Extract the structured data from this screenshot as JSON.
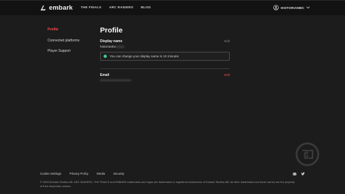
{
  "header": {
    "logo_text": "embark",
    "nav": [
      "THE FINALS",
      "ARC RAIDERS",
      "BLOG"
    ],
    "user_name": "HISTORIANBC"
  },
  "sidebar": {
    "items": [
      {
        "label": "Profile",
        "active": true
      },
      {
        "label": "Connected platforms",
        "active": false
      },
      {
        "label": "Player Support",
        "active": false
      }
    ]
  },
  "main": {
    "title": "Profile",
    "display_name": {
      "label": "Display name",
      "value": "historianbc",
      "edit_label": "Edit",
      "notice": "You can change your display name in 10 minutes"
    },
    "email": {
      "label": "Email",
      "value": "•••••••••••••••••••••••••••",
      "edit_label": "Edit"
    }
  },
  "footer": {
    "links": [
      "Cookie Settings",
      "Privacy Policy",
      "Media",
      "Security"
    ],
    "legal": "© 2025 Embark Studios AB. ARC RAIDERS, THE FINALS and EMBARK trademarks and logos are trademarks or registered trademarks of Embark Studios AB. All other trademarks and trade names are the property of their respective owners."
  },
  "colors": {
    "accent": "#ff4a4a",
    "background": "#1c1c1c",
    "topbar": "#121212",
    "notice_icon": "#3ecf8e"
  },
  "icons": [
    "embark-logo-icon",
    "user-avatar-icon",
    "chevron-down-icon",
    "info-icon",
    "discord-icon",
    "twitter-icon",
    "watermark-logo-icon"
  ]
}
